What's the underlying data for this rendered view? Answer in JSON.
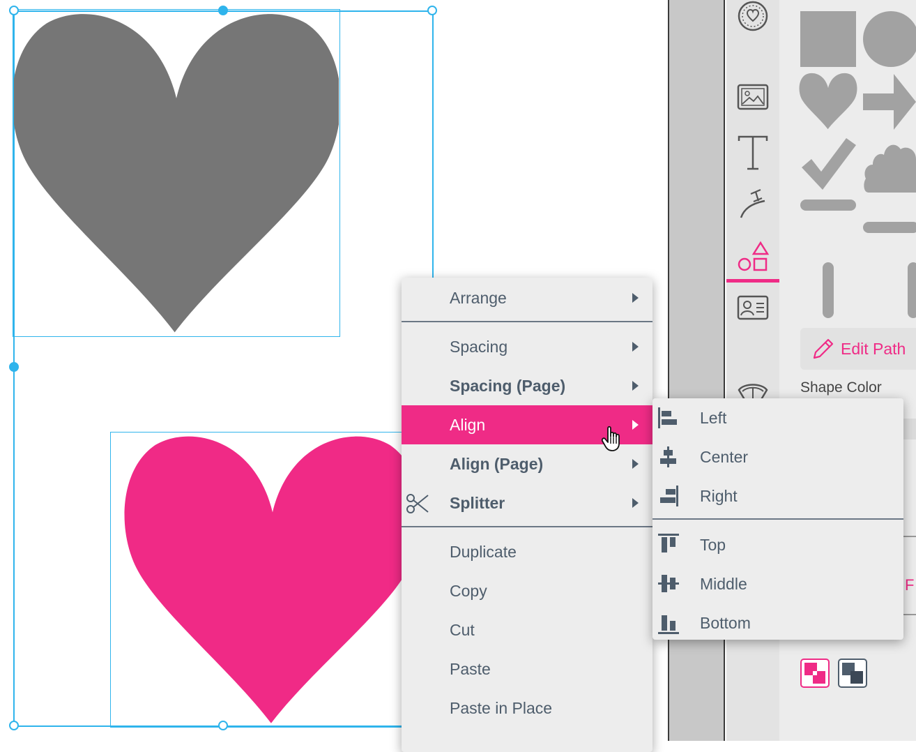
{
  "colors": {
    "accent": "#ef2b86",
    "selection": "#2fb4ec",
    "heart_gray": "#767676",
    "heart_pink": "#f02a86",
    "menu_text": "#4e5d6c"
  },
  "context_menu": {
    "items": [
      {
        "label": "Arrange",
        "submenu": true
      },
      {
        "label": "Spacing",
        "submenu": true
      },
      {
        "label": "Spacing (Page)",
        "submenu": true
      },
      {
        "label": "Align",
        "submenu": true,
        "active": true
      },
      {
        "label": "Align (Page)",
        "submenu": true
      },
      {
        "label": "Splitter",
        "submenu": true,
        "icon": "scissors-icon"
      },
      {
        "label": "Duplicate"
      },
      {
        "label": "Copy"
      },
      {
        "label": "Cut"
      },
      {
        "label": "Paste"
      },
      {
        "label": "Paste in Place"
      }
    ]
  },
  "align_submenu": {
    "items": [
      {
        "label": "Left",
        "icon": "align-left-icon"
      },
      {
        "label": "Center",
        "icon": "align-center-icon"
      },
      {
        "label": "Right",
        "icon": "align-right-icon"
      },
      {
        "label": "Top",
        "icon": "align-top-icon"
      },
      {
        "label": "Middle",
        "icon": "align-middle-icon"
      },
      {
        "label": "Bottom",
        "icon": "align-bottom-icon"
      }
    ]
  },
  "tool_rail": {
    "tools": [
      "heart-badge-icon",
      "image-icon",
      "text-icon",
      "path-text-icon",
      "shapes-icon",
      "contact-card-icon",
      "fan-icon"
    ],
    "active": "shapes-icon"
  },
  "shape_panel": {
    "shapes": [
      "square-shape-icon",
      "circle-shape-icon",
      "heart-shape-icon",
      "arrow-shape-icon",
      "check-shape-icon",
      "cloud-shape-icon",
      "horizontal-bar-icon",
      "vertical-bar-icon"
    ],
    "edit_path_label": "Edit Path",
    "shape_color_label": "Shape Color"
  }
}
